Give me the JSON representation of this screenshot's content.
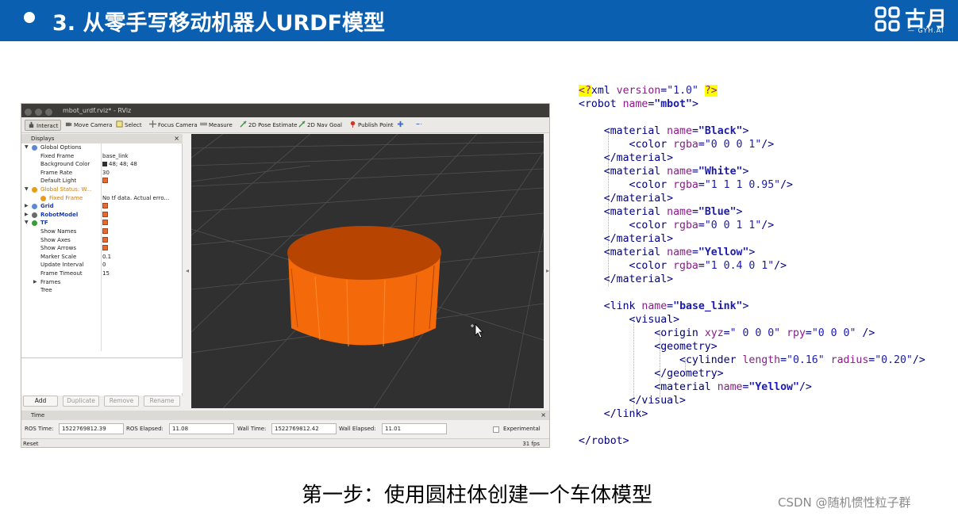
{
  "slide": {
    "title": "3. 从零手写移动机器人URDF模型",
    "logo_text": "古月",
    "logo_sub": "— GYH.AI",
    "caption": "第一步：使用圆柱体创建一个车体模型",
    "watermark": "CSDN @随机惯性粒子群",
    "header_color": "#0a5fb0"
  },
  "rviz": {
    "window_title": "mbot_urdf.rviz* - RViz",
    "toolbar": [
      {
        "label": "Interact",
        "icon": "interact-icon",
        "active": true
      },
      {
        "label": "Move Camera",
        "icon": "move-camera-icon"
      },
      {
        "label": "Select",
        "icon": "select-icon"
      },
      {
        "label": "Focus Camera",
        "icon": "focus-camera-icon"
      },
      {
        "label": "Measure",
        "icon": "measure-icon"
      },
      {
        "label": "2D Pose Estimate",
        "icon": "pose-estimate-icon"
      },
      {
        "label": "2D Nav Goal",
        "icon": "nav-goal-icon"
      },
      {
        "label": "Publish Point",
        "icon": "publish-point-icon"
      }
    ],
    "displays_title": "Displays",
    "tree": [
      {
        "key": "Global Options",
        "value": ""
      },
      {
        "key": "Fixed Frame",
        "value": "base_link"
      },
      {
        "key": "Background Color",
        "value": "48; 48; 48"
      },
      {
        "key": "Frame Rate",
        "value": "30"
      },
      {
        "key": "Default Light",
        "value": ""
      },
      {
        "key": "Global Status: W...",
        "value": ""
      },
      {
        "key": "Fixed Frame",
        "value": "No tf data.  Actual erro..."
      },
      {
        "key": "Grid",
        "value": ""
      },
      {
        "key": "RobotModel",
        "value": ""
      },
      {
        "key": "TF",
        "value": ""
      },
      {
        "key": "Show Names",
        "value": ""
      },
      {
        "key": "Show Axes",
        "value": ""
      },
      {
        "key": "Show Arrows",
        "value": ""
      },
      {
        "key": "Marker Scale",
        "value": "0.1"
      },
      {
        "key": "Update Interval",
        "value": "0"
      },
      {
        "key": "Frame Timeout",
        "value": "15"
      },
      {
        "key": "Frames",
        "value": ""
      },
      {
        "key": "Tree",
        "value": ""
      }
    ],
    "buttons": {
      "add": "Add",
      "duplicate": "Duplicate",
      "remove": "Remove",
      "rename": "Rename"
    },
    "time_title": "Time",
    "time": {
      "ros_time_label": "ROS Time:",
      "ros_time": "1522769812.39",
      "ros_elapsed_label": "ROS Elapsed:",
      "ros_elapsed": "11.08",
      "wall_time_label": "Wall Time:",
      "wall_time": "1522769812.42",
      "wall_elapsed_label": "Wall Elapsed:",
      "wall_elapsed": "11.01",
      "experimental_label": "Experimental"
    },
    "reset_label": "Reset",
    "fps": "31 fps",
    "background_color": "#303030",
    "cylinder_color": "#f46a0a"
  }
}
